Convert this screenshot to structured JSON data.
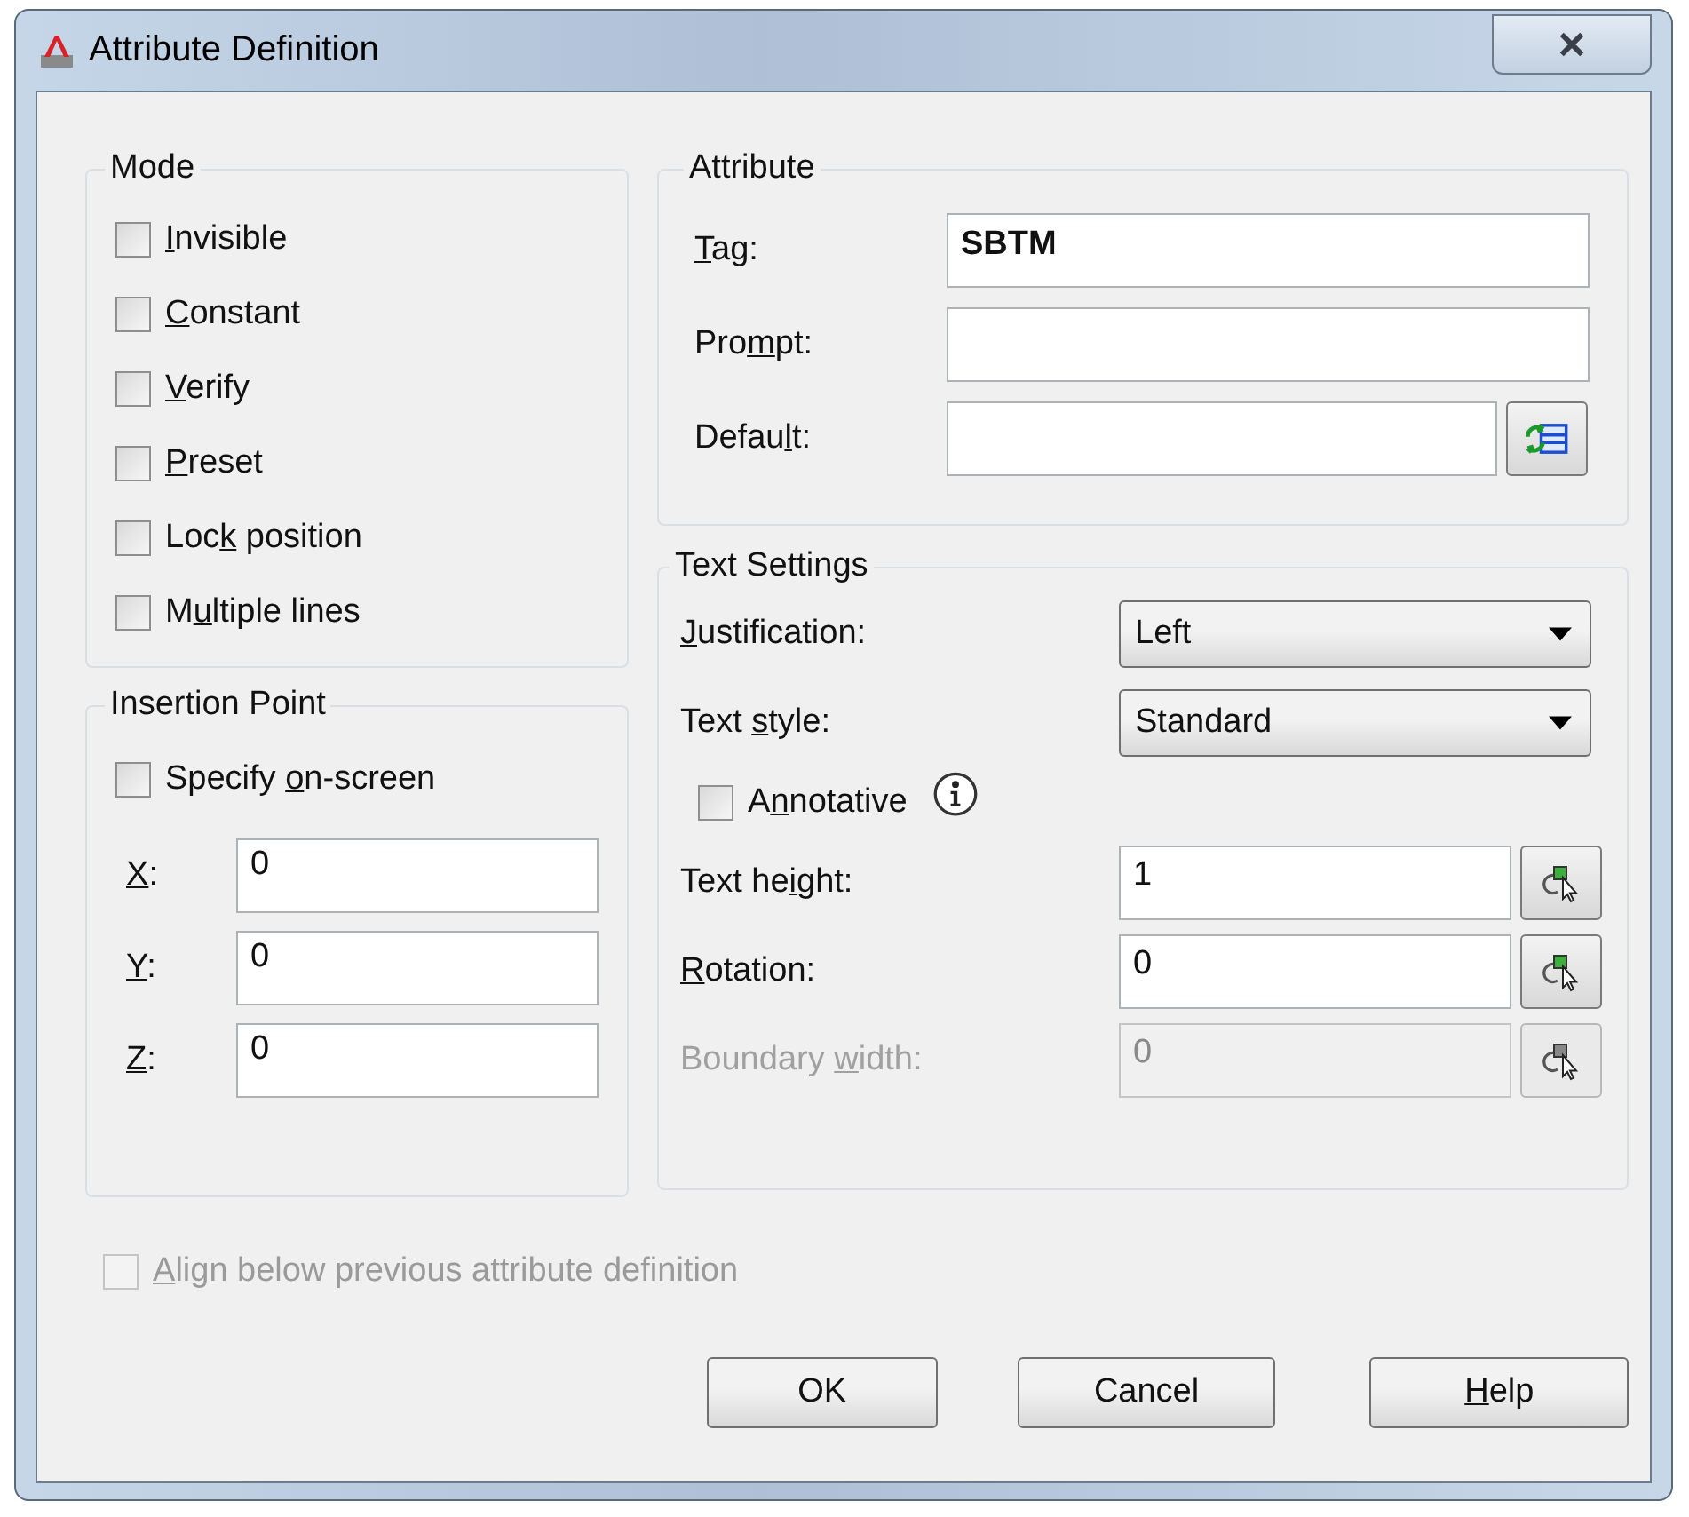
{
  "window": {
    "title": "Attribute Definition"
  },
  "mode": {
    "title": "Mode",
    "options": [
      {
        "label": [
          {
            "t": "I",
            "u": true
          },
          {
            "t": "nvisible"
          }
        ],
        "checked": false
      },
      {
        "label": [
          {
            "t": "C",
            "u": true
          },
          {
            "t": "onstant"
          }
        ],
        "checked": false
      },
      {
        "label": [
          {
            "t": "V",
            "u": true
          },
          {
            "t": "erify"
          }
        ],
        "checked": false
      },
      {
        "label": [
          {
            "t": "P",
            "u": true
          },
          {
            "t": "reset"
          }
        ],
        "checked": false
      },
      {
        "label": [
          {
            "t": "Loc"
          },
          {
            "t": "k",
            "u": true
          },
          {
            "t": " position"
          }
        ],
        "checked": false
      },
      {
        "label": [
          {
            "t": "M"
          },
          {
            "t": "u",
            "u": true
          },
          {
            "t": "ltiple lines"
          }
        ],
        "checked": false
      }
    ]
  },
  "insertion_point": {
    "title": "Insertion Point",
    "specify_on_screen": {
      "label": [
        {
          "t": "Specify "
        },
        {
          "t": "o",
          "u": true
        },
        {
          "t": "n-screen"
        }
      ],
      "checked": false
    },
    "coords": [
      {
        "label": [
          {
            "t": "X",
            "u": true
          },
          {
            "t": ":"
          }
        ],
        "value": "0"
      },
      {
        "label": [
          {
            "t": "Y",
            "u": true
          },
          {
            "t": ":"
          }
        ],
        "value": "0"
      },
      {
        "label": [
          {
            "t": "Z",
            "u": true
          },
          {
            "t": ":"
          }
        ],
        "value": "0"
      }
    ]
  },
  "attribute": {
    "title": "Attribute",
    "fields": [
      {
        "kind": "plain",
        "label": [
          {
            "t": "T",
            "u": true
          },
          {
            "t": "ag:"
          }
        ],
        "value": "SBTM"
      },
      {
        "kind": "plain",
        "label": [
          {
            "t": "Pro"
          },
          {
            "t": "m",
            "u": true
          },
          {
            "t": "pt:"
          }
        ]
      },
      {
        "kind": "insert",
        "label": [
          {
            "t": "Defau"
          },
          {
            "t": "l",
            "u": true
          },
          {
            "t": "t:"
          }
        ]
      }
    ]
  },
  "text_settings": {
    "title": "Text Settings",
    "rows": [
      {
        "kind": "dropdown",
        "label": [
          {
            "t": "J",
            "u": true
          },
          {
            "t": "ustification:"
          }
        ],
        "value": "Left"
      },
      {
        "kind": "dropdown",
        "label": [
          {
            "t": "Text "
          },
          {
            "t": "s",
            "u": true
          },
          {
            "t": "tyle:"
          }
        ],
        "value": "Standard"
      },
      {
        "kind": "checkbox",
        "label": [
          {
            "t": "A"
          },
          {
            "t": "n",
            "u": true
          },
          {
            "t": "notative"
          }
        ],
        "checked": false
      },
      {
        "kind": "pick",
        "label": [
          {
            "t": "Text he"
          },
          {
            "t": "i",
            "u": true
          },
          {
            "t": "ght:"
          }
        ],
        "value": "1",
        "disabled": false
      },
      {
        "kind": "pick",
        "label": [
          {
            "t": "R",
            "u": true
          },
          {
            "t": "otation:"
          }
        ],
        "value": "0",
        "disabled": false
      },
      {
        "kind": "pick",
        "label": [
          {
            "t": "Boundary "
          },
          {
            "t": "w",
            "u": true
          },
          {
            "t": "idth:"
          }
        ],
        "value": "0",
        "disabled": true
      }
    ]
  },
  "align_below": {
    "label": [
      {
        "t": "A",
        "u": true
      },
      {
        "t": "lign below previous attribute definition"
      }
    ],
    "checked": false,
    "disabled": true
  },
  "buttons": [
    {
      "label": [
        {
          "t": "OK"
        }
      ]
    },
    {
      "label": [
        {
          "t": "Cancel"
        }
      ]
    },
    {
      "label": [
        {
          "t": "H",
          "u": true
        },
        {
          "t": "elp"
        }
      ]
    }
  ]
}
